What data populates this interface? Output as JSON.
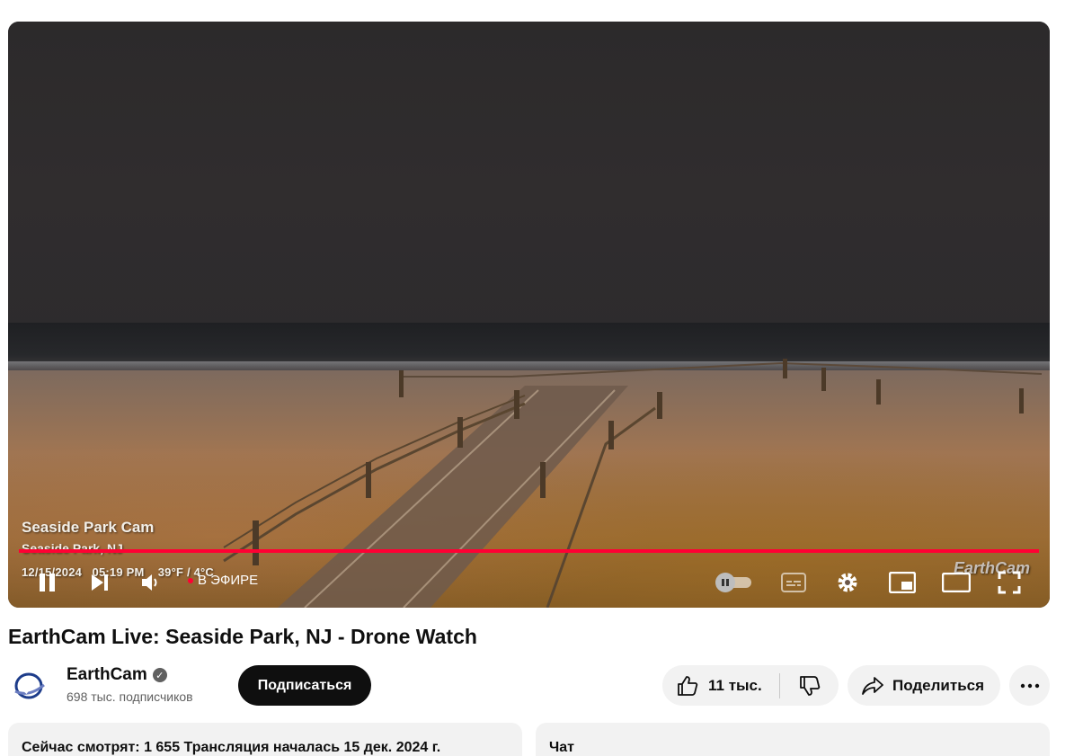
{
  "player": {
    "overlay": {
      "cam_title": "Seaside Park Cam",
      "location": "Seaside Park, NJ",
      "date": "12/15/2024",
      "time": "05:19 PM",
      "temperature": "39°F / 4°C",
      "logo": "EarthCam"
    },
    "live_label": "В ЭФИРЕ",
    "colors": {
      "progress": "#ff0033"
    }
  },
  "video": {
    "title": "EarthCam Live: Seaside Park, NJ - Drone Watch"
  },
  "channel": {
    "name": "EarthCam",
    "subscribers": "698 тыс. подписчиков",
    "subscribe_label": "Подписаться",
    "verified_icon": "check-circle-icon"
  },
  "actions": {
    "likes": "11 тыс.",
    "share_label": "Поделиться"
  },
  "description": {
    "summary": "Сейчас смотрят: 1 655  Трансляция началась 15 дек. 2024 г."
  },
  "chat": {
    "title": "Чат"
  }
}
